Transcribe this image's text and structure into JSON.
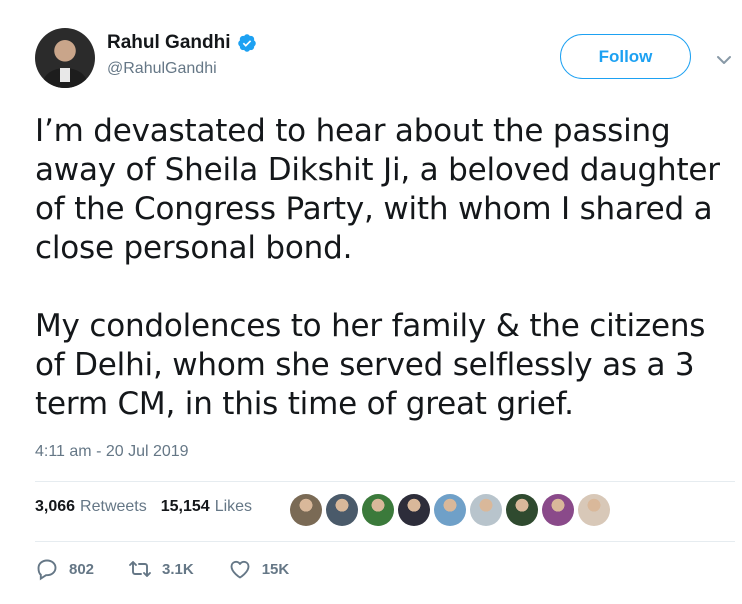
{
  "user": {
    "name": "Rahul Gandhi",
    "handle": "@RahulGandhi",
    "verified_icon": "verified-badge-icon"
  },
  "follow_label": "Follow",
  "tweet": {
    "paragraphs": [
      "I’m devastated to hear about the passing away of Sheila Dikshit Ji, a beloved daughter of the Congress Party, with whom I shared a close personal bond.",
      "My condolences to her family & the citizens of Delhi, whom she served selflessly as a 3 term CM, in this time of great grief."
    ],
    "timestamp": "4:11 am - 20 Jul 2019"
  },
  "stats": {
    "retweets_count": "3,066",
    "retweets_label": "Retweets",
    "likes_count": "15,154",
    "likes_label": "Likes"
  },
  "liker_avatars": [
    {
      "name": "liker-avatar-1",
      "color": "#7a6a55"
    },
    {
      "name": "liker-avatar-2",
      "color": "#4a5a6a"
    },
    {
      "name": "liker-avatar-3",
      "color": "#3b7a3b"
    },
    {
      "name": "liker-avatar-4",
      "color": "#2d2d3a"
    },
    {
      "name": "liker-avatar-5",
      "color": "#6fa0c8"
    },
    {
      "name": "liker-avatar-6",
      "color": "#b8c4cc"
    },
    {
      "name": "liker-avatar-7",
      "color": "#2f4a2f"
    },
    {
      "name": "liker-avatar-8",
      "color": "#8a4a8a"
    },
    {
      "name": "liker-avatar-9",
      "color": "#d8c8b8"
    }
  ],
  "actions": {
    "reply_count": "802",
    "retweet_count": "3.1K",
    "like_count": "15K"
  },
  "colors": {
    "accent": "#1da1f2",
    "text": "#14171a",
    "muted": "#657786"
  }
}
